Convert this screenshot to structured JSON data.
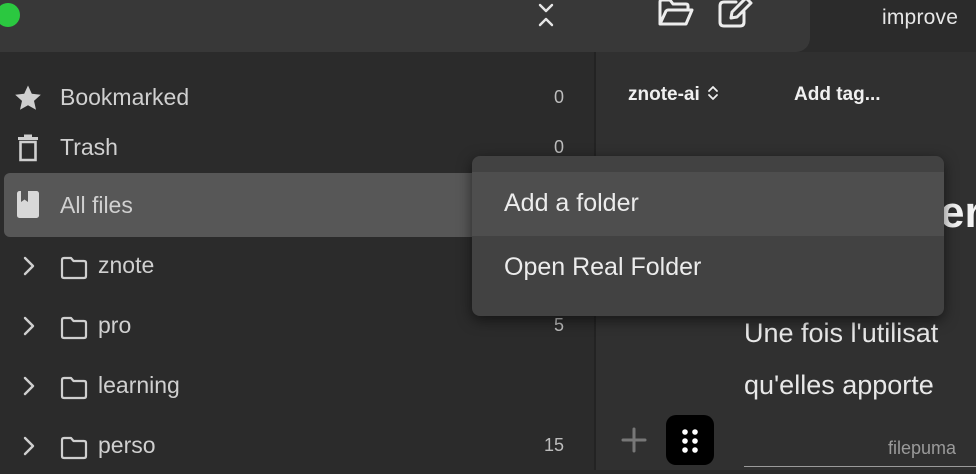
{
  "topbar": {
    "doc_title": "improve"
  },
  "sidebar": {
    "bookmarked": {
      "label": "Bookmarked",
      "count": "0"
    },
    "trash": {
      "label": "Trash",
      "count": "0"
    },
    "all_files": {
      "label": "All files"
    },
    "folders": [
      {
        "label": "znote",
        "count": ""
      },
      {
        "label": "pro",
        "count": "5"
      },
      {
        "label": "learning",
        "count": ""
      },
      {
        "label": "perso",
        "count": "15"
      }
    ]
  },
  "context_menu": {
    "items": [
      {
        "label": "Add a folder"
      },
      {
        "label": "Open Real Folder"
      }
    ]
  },
  "editor": {
    "workspace": "znote-ai",
    "add_tag": "Add tag...",
    "heading_fragment": "er",
    "paragraph_line_1": "Une fois l'utilisat",
    "paragraph_line_2": "qu'elles apporte",
    "caption": "filepuma"
  }
}
